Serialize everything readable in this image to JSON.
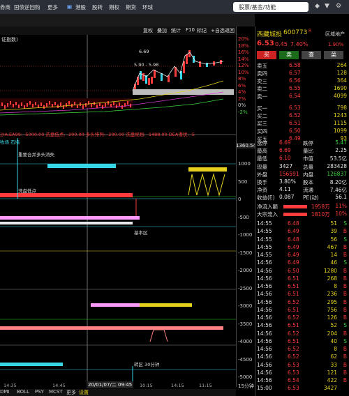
{
  "topbar": {
    "menus": [
      "券商",
      "国债逆回购",
      "更多",
      "港股",
      "股转",
      "期权",
      "期货",
      "环球"
    ],
    "search_placeholder": "股票/基金/功能"
  },
  "subbar": {
    "buttons": [
      "复权",
      "叠加",
      "统计",
      "F10",
      "标记",
      "+自选",
      "返回"
    ]
  },
  "chart": {
    "main_label": "证指数)",
    "price_labels": {
      "high": "6.69",
      "low_pair": "5.90 - 5.98"
    },
    "indicator_line": "沙A:EA99: -5000.00   洗盘低点: -200.00   多头排列: -200.00   洗盘规划: -1488.00   DEA潜伏: -5",
    "sub_title": "牧场  石墙",
    "annotations": [
      "重要合并多头消失",
      "洗盘低点",
      "基本区",
      "转区 30分钟",
      "顶"
    ],
    "axis_value": "1360.54",
    "date_label": "20/01/07/二 09:45",
    "time_ticks": [
      "14:35",
      "14:45",
      "10:15",
      "14:15",
      "11:15"
    ]
  },
  "axis": {
    "pct_ticks": [
      "20%",
      "18%",
      "16%",
      "14%",
      "12%",
      "10%",
      "8%",
      "6%",
      "4%",
      "2%",
      "0%",
      "-2%"
    ],
    "vol_ticks": [
      "1000",
      "500",
      "0",
      "-500",
      "-1000",
      "-1500",
      "-2000",
      "-2500",
      "-3000",
      "-3500",
      "-4000",
      "-4500",
      "-5000"
    ],
    "period": "15分钟"
  },
  "stock": {
    "name": "西藏城投",
    "code": "600773",
    "flag": "R",
    "sector": "区域地产",
    "price": "6.53",
    "change": "0.45",
    "change_pct": "7.40%",
    "sector_pct": "1.90%",
    "buttons": {
      "buy": "买",
      "sell": "卖",
      "query": "查",
      "menu": "菜"
    }
  },
  "orderbook": {
    "asks": [
      {
        "label": "卖五",
        "price": "6.58",
        "vol": "264"
      },
      {
        "label": "卖四",
        "price": "6.57",
        "vol": "128"
      },
      {
        "label": "卖三",
        "price": "6.56",
        "vol": "364"
      },
      {
        "label": "卖二",
        "price": "6.55",
        "vol": "1690"
      },
      {
        "label": "卖一",
        "price": "6.54",
        "vol": "4099"
      }
    ],
    "bids": [
      {
        "label": "买一",
        "price": "6.53",
        "vol": "798"
      },
      {
        "label": "买二",
        "price": "6.52",
        "vol": "1243"
      },
      {
        "label": "买三",
        "price": "6.51",
        "vol": "1115"
      },
      {
        "label": "买四",
        "price": "6.50",
        "vol": "1099"
      },
      {
        "label": "买五",
        "price": "6.49",
        "vol": "93"
      }
    ]
  },
  "stats": [
    {
      "l1": "涨停",
      "v1": "6.69",
      "l2": "跌停",
      "v2": "5.47"
    },
    {
      "l1": "最高",
      "v1": "6.69",
      "l2": "量比",
      "v2": "2.25"
    },
    {
      "l1": "最低",
      "v1": "6.10",
      "l2": "市值",
      "v2": "53.5亿"
    },
    {
      "l1": "现量",
      "v1": "3427",
      "l2": "总量",
      "v2": "283428"
    },
    {
      "l1": "外盘",
      "v1": "156591",
      "l2": "内盘",
      "v2": "126837"
    },
    {
      "l1": "换手",
      "v1": "3.80%",
      "l2": "股本",
      "v2": "8.20亿"
    },
    {
      "l1": "净资",
      "v1": "4.11",
      "l2": "流通",
      "v2": "7.46亿"
    },
    {
      "l1": "收益(E)",
      "v1": "0.087",
      "l2": "PE(动)",
      "v2": "56.1"
    }
  ],
  "flows": [
    {
      "label": "净流入额",
      "value": "1958万",
      "pct": "11%"
    },
    {
      "label": "大宗流入",
      "value": "1810万",
      "pct": "10%"
    }
  ],
  "ticks": [
    {
      "t": "14:55",
      "p": "6.48",
      "v": "51",
      "d": "S"
    },
    {
      "t": "14:55",
      "p": "6.49",
      "v": "39",
      "d": "B"
    },
    {
      "t": "14:55",
      "p": "6.48",
      "v": "56",
      "d": "S"
    },
    {
      "t": "14:55",
      "p": "6.49",
      "v": "467",
      "d": "B"
    },
    {
      "t": "14:55",
      "p": "6.49",
      "v": "14",
      "d": "B"
    },
    {
      "t": "14:56",
      "p": "6.49",
      "v": "46",
      "d": "S"
    },
    {
      "t": "14:56",
      "p": "6.50",
      "v": "1280",
      "d": "B"
    },
    {
      "t": "14:56",
      "p": "6.51",
      "v": "268",
      "d": "B"
    },
    {
      "t": "14:56",
      "p": "6.51",
      "v": "8",
      "d": "B"
    },
    {
      "t": "14:56",
      "p": "6.51",
      "v": "236",
      "d": "B"
    },
    {
      "t": "14:56",
      "p": "6.52",
      "v": "295",
      "d": "B"
    },
    {
      "t": "14:56",
      "p": "6.51",
      "v": "756",
      "d": "B"
    },
    {
      "t": "14:56",
      "p": "6.52",
      "v": "126",
      "d": "B"
    },
    {
      "t": "14:56",
      "p": "6.51",
      "v": "52",
      "d": "S"
    },
    {
      "t": "14:56",
      "p": "6.52",
      "v": "204",
      "d": "B"
    },
    {
      "t": "14:56",
      "p": "6.51",
      "v": "40",
      "d": "S"
    },
    {
      "t": "14:56",
      "p": "6.52",
      "v": "8",
      "d": "B"
    },
    {
      "t": "14:56",
      "p": "6.52",
      "v": "62",
      "d": "B"
    },
    {
      "t": "14:56",
      "p": "6.53",
      "v": "33",
      "d": "B"
    },
    {
      "t": "14:56",
      "p": "6.53",
      "v": "121",
      "d": "B"
    },
    {
      "t": "14:56",
      "p": "6.54",
      "v": "422",
      "d": "B"
    },
    {
      "t": "15:00",
      "p": "6.53",
      "v": "3427",
      "d": ""
    }
  ],
  "bottom_tabs": [
    "DMI",
    "BOLL",
    "PSY",
    "MCST",
    "更多",
    "设置"
  ],
  "colors": {
    "up": "#ff3b3b",
    "down": "#3bd73b",
    "accent": "#e6d21e",
    "bg": "#000000"
  }
}
